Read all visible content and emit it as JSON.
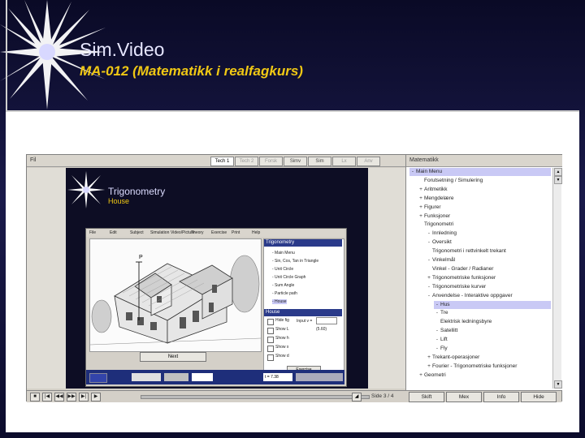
{
  "slide": {
    "title": "Sim.Video",
    "subtitle": "MA-012 (Matematikk i realfagkurs)"
  },
  "app": {
    "menubar": {
      "file_label": "Fil",
      "tabs": [
        {
          "label": "Tech 1",
          "state": "active"
        },
        {
          "label": "Tech 2",
          "state": "disabled"
        },
        {
          "label": "Forsk",
          "state": "disabled"
        },
        {
          "label": "Simv",
          "state": "normal"
        },
        {
          "label": "Sim",
          "state": "normal"
        },
        {
          "label": "Lx",
          "state": "disabled"
        },
        {
          "label": "Anv",
          "state": "disabled"
        }
      ]
    },
    "video": {
      "title": "Trigonometry",
      "subtitle": "House",
      "inner_menu": [
        "File",
        "Edit",
        "Subject",
        "Simulation",
        "Video/Picture",
        "Theory",
        "Exercise",
        "Print",
        "Help"
      ],
      "inner_panel": {
        "header": "Trigonometry",
        "items": [
          "Main Menu",
          "Sin, Cos, Tan in Triangle",
          "Unit Circle",
          "Unit Circle Graph",
          "Sum Angle",
          "Particle path",
          "House"
        ],
        "selected_item": "House",
        "lower_header": "House",
        "checks": [
          "Hide fig",
          "Show L",
          "Show h",
          "Show x",
          "Show d"
        ],
        "input_label": "Input v =",
        "value": "(5.60)",
        "exercise_button": "Exercise"
      },
      "next_button": "Next",
      "status_value": "t = 7.38"
    },
    "tree": {
      "header": "Matematikk",
      "rows": [
        {
          "icon": "-",
          "label": "Main Menu",
          "indent": 0,
          "selected": true
        },
        {
          "icon": "",
          "label": "Forutsetning / Simulering",
          "indent": 1
        },
        {
          "icon": "+",
          "label": "Aritmetikk",
          "indent": 1
        },
        {
          "icon": "+",
          "label": "Mengdelære",
          "indent": 1
        },
        {
          "icon": "+",
          "label": "Figurer",
          "indent": 1
        },
        {
          "icon": "+",
          "label": "Funksjoner",
          "indent": 1
        },
        {
          "icon": "",
          "label": "Trigonometri",
          "indent": 1
        },
        {
          "icon": "-",
          "label": "Innledning",
          "indent": 2
        },
        {
          "icon": "-",
          "label": "Oversikt",
          "indent": 2
        },
        {
          "icon": "",
          "label": "Trigonometri i rettvinkelt trekant",
          "indent": 2
        },
        {
          "icon": "-",
          "label": "Vinkelmål",
          "indent": 2
        },
        {
          "icon": "",
          "label": "Vinkel - Grader / Radianer",
          "indent": 2
        },
        {
          "icon": "+",
          "label": "Trigonometriske funksjoner",
          "indent": 2
        },
        {
          "icon": "-",
          "label": "Trigonometriske kurver",
          "indent": 2
        },
        {
          "icon": "-",
          "label": "Anvendelse - Interaktive oppgaver",
          "indent": 2
        },
        {
          "icon": "-",
          "label": "Hus",
          "indent": 3,
          "selected": true
        },
        {
          "icon": "-",
          "label": "Tre",
          "indent": 3
        },
        {
          "icon": "",
          "label": "Elektrisk ledningsbyre",
          "indent": 3
        },
        {
          "icon": "-",
          "label": "Satellitt",
          "indent": 3
        },
        {
          "icon": "-",
          "label": "Lift",
          "indent": 3
        },
        {
          "icon": "-",
          "label": "Fly",
          "indent": 3
        },
        {
          "icon": "+",
          "label": "Trekant-operasjoner",
          "indent": 2
        },
        {
          "icon": "+",
          "label": "Fourier - Trigonometriske funksjoner",
          "indent": 2
        },
        {
          "icon": "+",
          "label": "Geometri",
          "indent": 1
        }
      ]
    },
    "bottombar": {
      "transport_icons": [
        "stop-icon",
        "rewind-start-icon",
        "rewind-icon",
        "fast-forward-icon",
        "forward-end-icon",
        "play-icon"
      ],
      "page_indicator": "Side 3 / 4",
      "buttons": [
        "Skift",
        "Mex",
        "Info",
        "Hide"
      ]
    }
  }
}
